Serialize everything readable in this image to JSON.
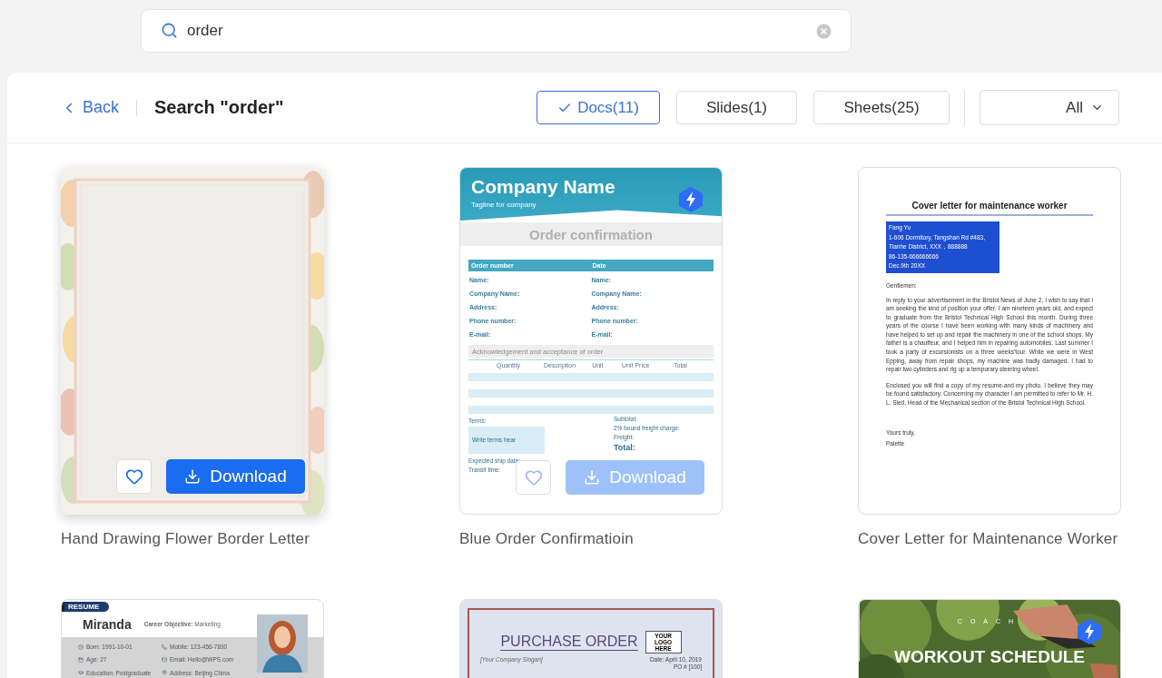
{
  "search": {
    "value": "order"
  },
  "header": {
    "back": "Back",
    "title": "Search \"order\"",
    "filters": [
      {
        "label": "Docs(11)",
        "selected": true
      },
      {
        "label": "Slides(1)",
        "selected": false
      },
      {
        "label": "Sheets(25)",
        "selected": false
      }
    ],
    "dropdown": "All"
  },
  "cards": [
    {
      "title": "Hand Drawing Flower Border Letter",
      "hovered": true,
      "premium": false,
      "actions": {
        "label": "Download",
        "faded": false
      }
    },
    {
      "title": "Blue Order Confirmatioin",
      "hovered": false,
      "premium": true,
      "actions": {
        "label": "Download",
        "faded": true
      },
      "thumb": {
        "kind": "order",
        "company": "Company Name",
        "tagline": "Tagline for company",
        "heading": "Order confirmation",
        "bar": [
          "Order number",
          "Date"
        ],
        "fields": [
          "Name:",
          "Company Name:",
          "Address:",
          "Phone number:",
          "E-mail:"
        ],
        "fields_right": [
          "Name:",
          "Company Name:",
          "Address:",
          "Phone number:",
          "E-mail:"
        ],
        "ack": "Acknowledgement and acceptance of order",
        "columns": [
          "Quantity",
          "Description",
          "Unit",
          "Unit Price",
          "Total"
        ],
        "terms": "Terms:",
        "totals": [
          "Subtotal:",
          "2% bound freight charge:",
          "Freight:"
        ],
        "total": "Total:",
        "terms_box": "Write terms hear",
        "footer": [
          "Expected ship date:",
          "Transit time:"
        ]
      }
    },
    {
      "title": "Cover Letter for Maintenance Worker",
      "hovered": false,
      "premium": false,
      "thumb": {
        "kind": "letter",
        "heading": "Cover letter for maintenance worker",
        "address": [
          "Fang Yu",
          "1-606 Dormitory, Tangshan Rd #483,",
          "Tianhe District, XXX，888888",
          "86-135-666666666",
          "Dec.9th 20XX"
        ],
        "greeting": "Gentlemen:",
        "paragraphs": [
          "In reply to your advertisement in the Bristol News of June 2, I wish to say that I am seeking the kind of position your offer. I am nineteen years old, and expect to graduate from the Bristol Technical High School this month. During three years of the course I have been working with many kinds of machinery and have helped to set up and repair the machinery in one of the school shops. My father is a chauffeur, and I helped him in repairing automobiles. Last summer I took a party of excursionists on a three weeks'tour. While we were in West Epping, away from repair shops, my machine was badly damaged. I had to repair two cylinders and rig up a temporary steering wheel.",
          "Enclosed you will find a copy of my resume-and my photo. I believe they may be found satisfactory. Concerning my character I am permitted to refer to Mr. H. L. Sled, Head of the Mechanical section of the Bristol Technical High School."
        ],
        "closing": "Yours truly,",
        "signature": "Palette"
      }
    },
    {
      "hovered": false,
      "premium": false,
      "thumb": {
        "kind": "resume",
        "tag": "RESUME",
        "name": "Miranda",
        "objective": "**Career Objective:** Marketing",
        "details": [
          "Born:  1991-10-01",
          "Mobile:  123-456-7890",
          "Age:  27",
          "Email:  Hello@WPS.com",
          "Education:  Postgraduate",
          "Address:  Beijing China"
        ]
      }
    },
    {
      "hovered": false,
      "premium": false,
      "thumb": {
        "kind": "purchase",
        "heading": "PURCHASE ORDER",
        "logo": "YOUR LOGO HERE",
        "slogan": "[Your Company Slogan]",
        "date": "Date: April 10, 2019",
        "po": "PO # [100]"
      }
    },
    {
      "hovered": false,
      "premium": true,
      "thumb": {
        "kind": "workout",
        "overline": "COACH",
        "heading": "WORKOUT SCHEDULE"
      }
    }
  ]
}
